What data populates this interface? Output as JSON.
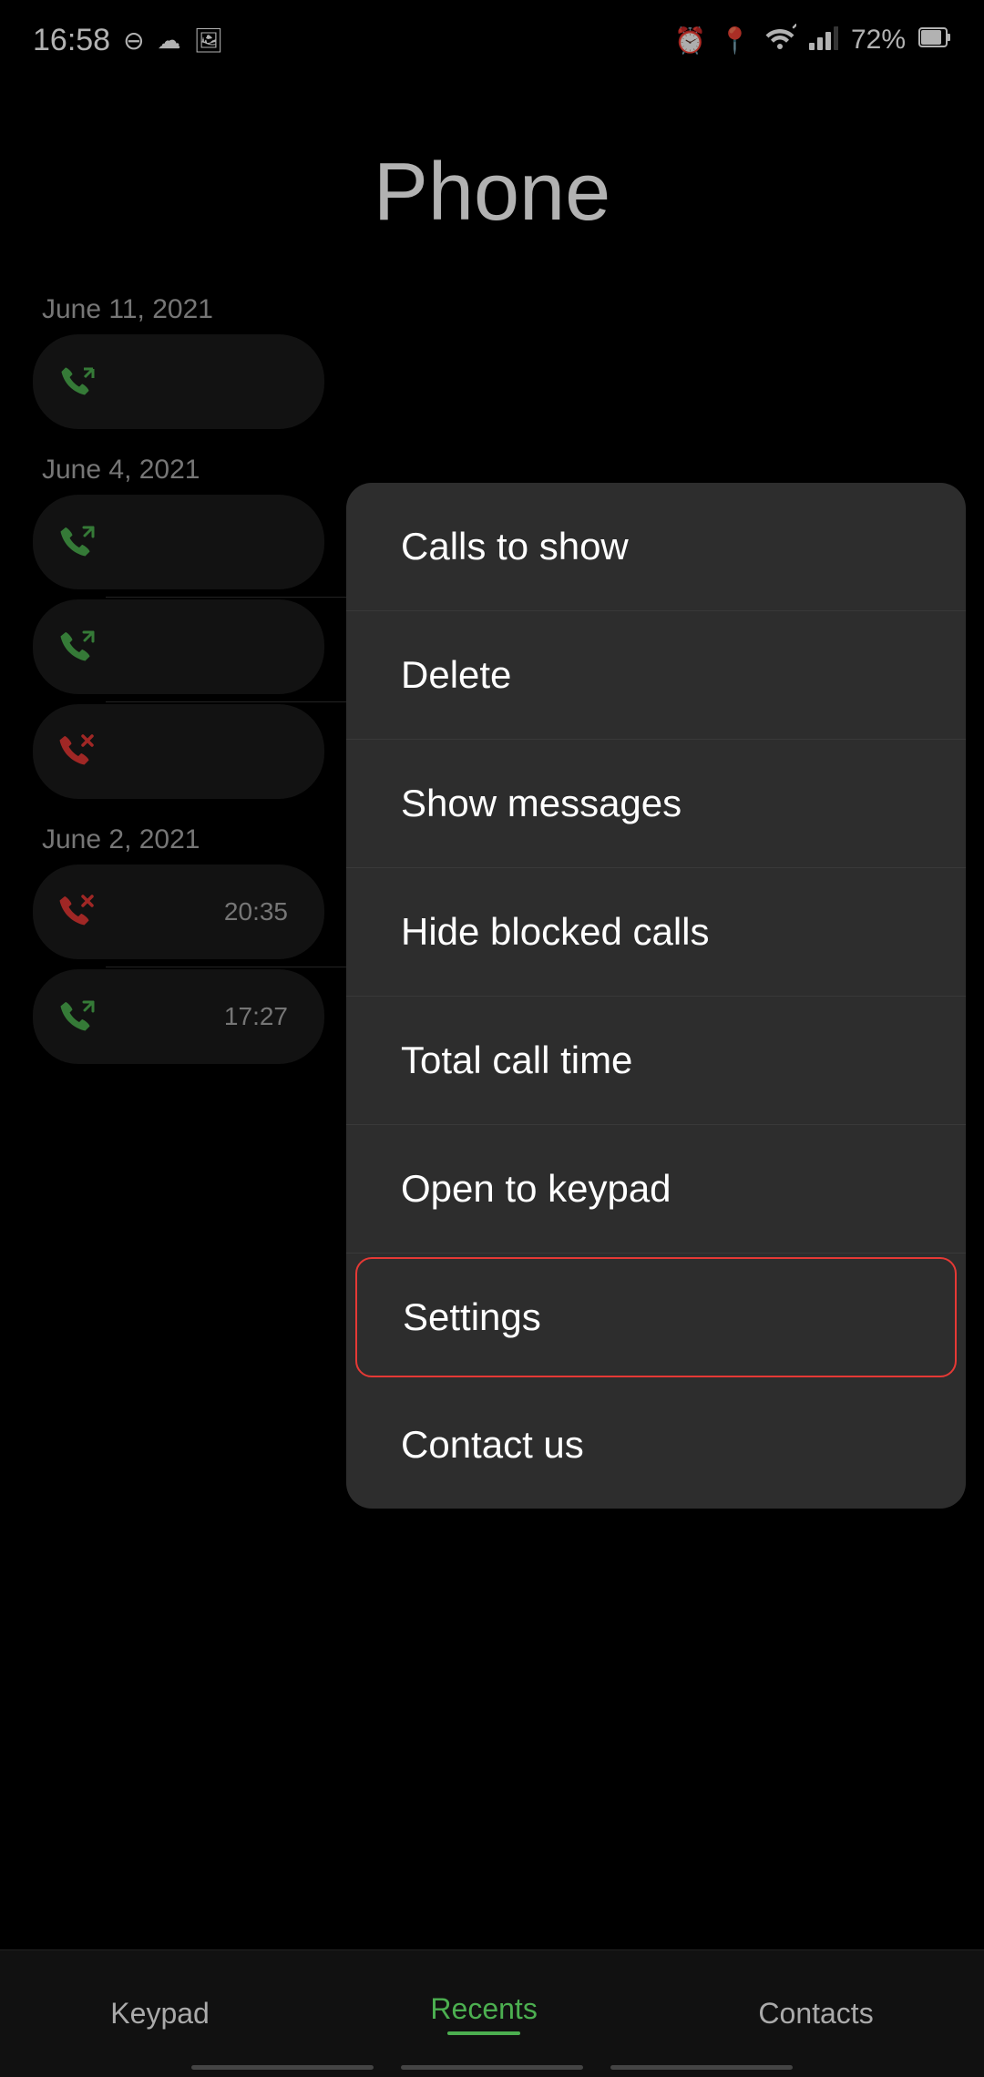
{
  "statusBar": {
    "time": "16:58",
    "leftIcons": [
      "⊖",
      "☁",
      "🖼"
    ],
    "rightIcons": [
      "⏰",
      "📍",
      "wifi",
      "signal",
      "72%",
      "🔋"
    ]
  },
  "pageTitle": "Phone",
  "callList": [
    {
      "date": "June 11, 2021",
      "calls": [
        {
          "type": "outgoing",
          "time": ""
        }
      ]
    },
    {
      "date": "June 4, 2021",
      "calls": [
        {
          "type": "outgoing",
          "time": ""
        },
        {
          "type": "outgoing",
          "time": ""
        },
        {
          "type": "missed",
          "time": ""
        }
      ]
    },
    {
      "date": "June 2, 2021",
      "calls": [
        {
          "type": "missed",
          "time": "20:35"
        },
        {
          "type": "outgoing",
          "time": "17:27"
        }
      ]
    }
  ],
  "menu": {
    "items": [
      {
        "id": "calls-to-show",
        "label": "Calls to show",
        "active": false
      },
      {
        "id": "delete",
        "label": "Delete",
        "active": false
      },
      {
        "id": "show-messages",
        "label": "Show messages",
        "active": false
      },
      {
        "id": "hide-blocked-calls",
        "label": "Hide blocked calls",
        "active": false
      },
      {
        "id": "total-call-time",
        "label": "Total call time",
        "active": false
      },
      {
        "id": "open-to-keypad",
        "label": "Open to keypad",
        "active": false
      },
      {
        "id": "settings",
        "label": "Settings",
        "active": true
      },
      {
        "id": "contact-us",
        "label": "Contact us",
        "active": false
      }
    ]
  },
  "bottomNav": {
    "items": [
      {
        "id": "keypad",
        "label": "Keypad",
        "active": false
      },
      {
        "id": "recents",
        "label": "Recents",
        "active": true
      },
      {
        "id": "contacts",
        "label": "Contacts",
        "active": false
      }
    ]
  }
}
